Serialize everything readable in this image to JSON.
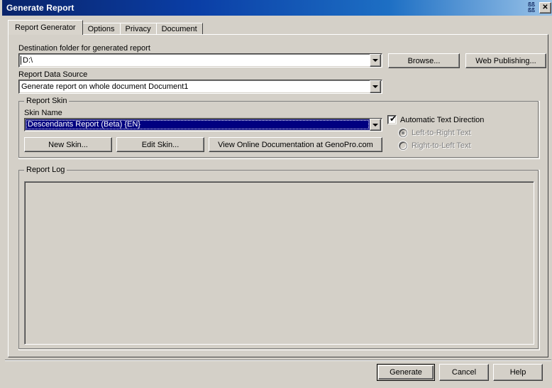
{
  "window": {
    "title": "Generate Report",
    "titlebar_glyph": "ßß\nßß",
    "close_label": "✕"
  },
  "tabs": [
    {
      "label": "Report Generator",
      "active": true
    },
    {
      "label": "Options",
      "active": false
    },
    {
      "label": "Privacy",
      "active": false
    },
    {
      "label": "Document",
      "active": false
    }
  ],
  "destination": {
    "label": "Destination folder for generated report",
    "value": "D:\\",
    "browse_label": "Browse...",
    "web_publishing_label": "Web Publishing..."
  },
  "data_source": {
    "label": "Report Data Source",
    "value": "Generate report on whole document Document1"
  },
  "report_skin": {
    "caption": "Report Skin",
    "skin_name_label": "Skin Name",
    "selected_skin": "Descendants Report (Beta)  {EN}",
    "new_skin_label": "New Skin...",
    "edit_skin_label": "Edit Skin...",
    "documentation_label": "View Online Documentation at GenoPro.com"
  },
  "text_direction": {
    "automatic_label": "Automatic Text Direction",
    "automatic_checked": true,
    "left_to_right_label": "Left-to-Right Text",
    "right_to_left_label": "Right-to-Left Text",
    "selected": "left_to_right",
    "radios_disabled": true,
    "check_glyph": "✔"
  },
  "report_log": {
    "caption": "Report Log",
    "content": ""
  },
  "footer": {
    "generate_label": "Generate",
    "cancel_label": "Cancel",
    "help_label": "Help"
  },
  "colors": {
    "face": "#d4d0c8",
    "title_start": "#0a246a",
    "title_end": "#9cc4e8",
    "highlight": "#000080",
    "highlight_text": "#ffffff",
    "disabled_text": "#808080"
  }
}
